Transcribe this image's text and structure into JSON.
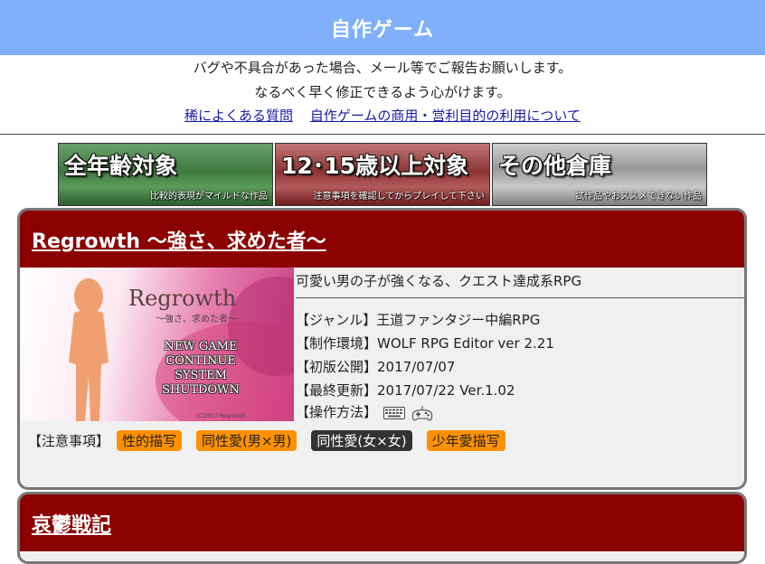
{
  "header": {
    "title": "自作ゲーム"
  },
  "notice": {
    "line1": "バグや不具合があった場合、メール等でご報告お願いします。",
    "line2": "なるべく早く修正できるよう心がけます。"
  },
  "links": {
    "faq": "稀によくある質問",
    "commercial": "自作ゲームの商用・営利目的の利用について"
  },
  "banners": [
    {
      "title": "全年齢対象",
      "subtitle": "比較的表現がマイルドな作品"
    },
    {
      "title": "12･15歳以上対象",
      "subtitle": "注意事項を確認してからプレイして下さい"
    },
    {
      "title": "その他倉庫",
      "subtitle": "試作品やおススメできない作品"
    }
  ],
  "games": [
    {
      "title": "Regrowth 〜強さ、求めた者〜",
      "description": "可愛い男の子が強くなる、クエスト達成系RPG",
      "thumb": {
        "logo": "Regrowth",
        "logo_sub": "〜強さ、求めた者〜",
        "menu": [
          "NEW GAME",
          "CONTINUE",
          "SYSTEM",
          "SHUTDOWN"
        ],
        "copyright": "(C)2017 Regrowth"
      },
      "info": [
        {
          "label": "【ジャンル】",
          "value": "王道ファンタジー中編RPG"
        },
        {
          "label": "【制作環境】",
          "value": "WOLF RPG Editor ver 2.21"
        },
        {
          "label": "【初版公開】",
          "value": "2017/07/07"
        },
        {
          "label": "【最終更新】",
          "value": "2017/07/22 Ver.1.02"
        }
      ],
      "controls_label": "【操作方法】",
      "controls_icons": [
        "keyboard-icon",
        "gamepad-icon"
      ],
      "tags_label": "【注意事項】",
      "tags": [
        "性的描写",
        "同性愛(男×男)",
        "同性愛(女×女)",
        "少年愛描写"
      ]
    },
    {
      "title": "哀鬱戦記"
    }
  ],
  "colors": {
    "header_bg": "#80b0fa",
    "card_title_bg": "#8b0000",
    "tag_orange": "#ff9100",
    "tag_dark": "#333333",
    "link": "#1a1aa6"
  }
}
